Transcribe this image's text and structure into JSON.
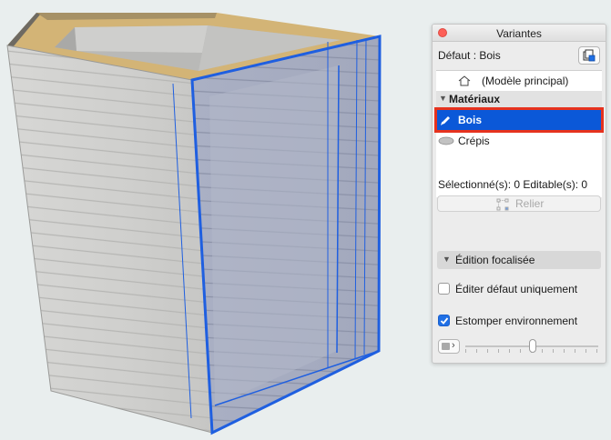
{
  "window": {
    "title": "Variantes"
  },
  "default_row": {
    "label": "Défaut : Bois"
  },
  "variants": {
    "main_model": {
      "label": "(Modèle principal)"
    },
    "materials_section": {
      "label": "Matériaux",
      "items": [
        {
          "label": "Bois",
          "selected": true
        },
        {
          "label": "Crépis",
          "selected": false
        }
      ]
    }
  },
  "selection": {
    "status": "Sélectionné(s): 0 Editable(s): 0"
  },
  "link_button": {
    "label": "Relier"
  },
  "focus_section": {
    "label": "Édition focalisée",
    "options": [
      {
        "label": "Éditer défaut uniquement",
        "checked": false
      },
      {
        "label": "Estomper environnement",
        "checked": true
      }
    ]
  },
  "colors": {
    "selection_blue": "#0b58d8",
    "highlight_red": "#e6321e",
    "edit_outline": "#1f5fe0",
    "wood_top": "#d3b476"
  }
}
